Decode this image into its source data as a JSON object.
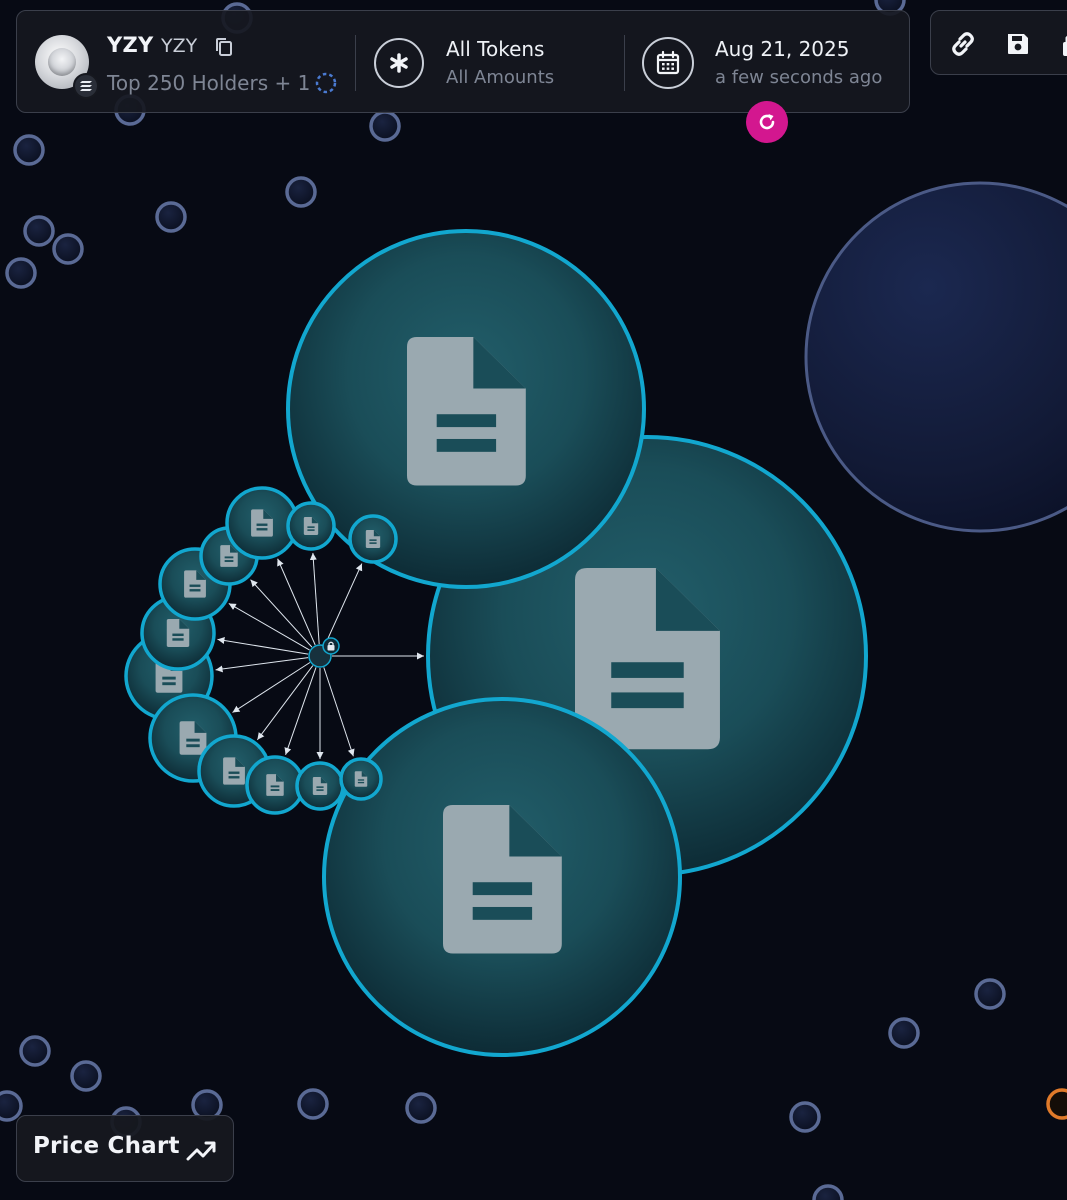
{
  "header": {
    "token_name": "YZY",
    "token_symbol": "YZY",
    "holders_label": "Top 250 Holders + 1",
    "filter_title": "All Tokens",
    "filter_subtitle": "All Amounts",
    "date_title": "Aug 21, 2025",
    "date_subtitle": "a few seconds ago"
  },
  "bottom": {
    "price_chart_label": "Price Chart"
  },
  "icons": {
    "token_logo": "token-logo",
    "chain": "chain-icon",
    "copy": "copy-icon",
    "loading": "spinner-icon",
    "filter": "asterisk-icon",
    "calendar": "calendar-icon",
    "refresh": "refresh-icon",
    "link": "link-icon",
    "save": "save-icon",
    "lock": "lock-icon",
    "holder_node": "document-icon",
    "trend": "trend-icon"
  },
  "colors": {
    "background": "#070a14",
    "node_border": "#12a7cf",
    "node_fill": "#1d5c6a",
    "document_icon": "#9aa9b0",
    "refresh_button": "#d3178f",
    "small_node_border": "#5a6a95",
    "large_blue_node_border": "#4b5a86",
    "orange_node_border": "#e07a2a"
  }
}
